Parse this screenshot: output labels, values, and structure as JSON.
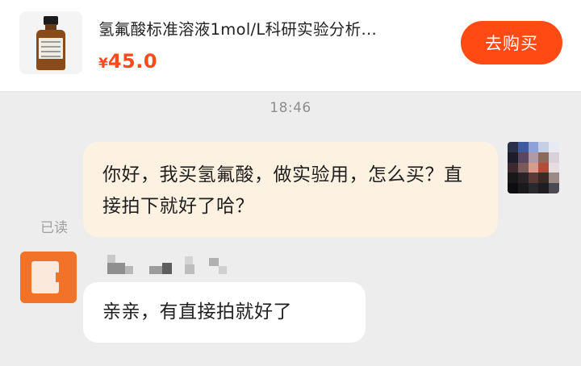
{
  "product": {
    "title": "氢氟酸标准溶液1mol/L科研实验分析…",
    "price_symbol": "¥",
    "price_value": "45.0",
    "buy_label": "去购买"
  },
  "chat": {
    "timestamp": "18:46",
    "read_status": "已读",
    "messages": [
      {
        "from": "me",
        "text": "你好，我买氢氟酸，做实验用，怎么买？直接拍下就好了哈？"
      },
      {
        "from": "other",
        "text": "亲亲，有直接拍就好了"
      }
    ]
  },
  "colors": {
    "accent": "#ff4a14",
    "outgoing_bubble": "#fdf1e2",
    "incoming_bubble": "#ffffff",
    "background": "#ededed"
  },
  "icons": {
    "product_image": "amber-reagent-bottle",
    "self_avatar": "pixelated-avatar",
    "shop_avatar": "orange-shop-logo"
  }
}
